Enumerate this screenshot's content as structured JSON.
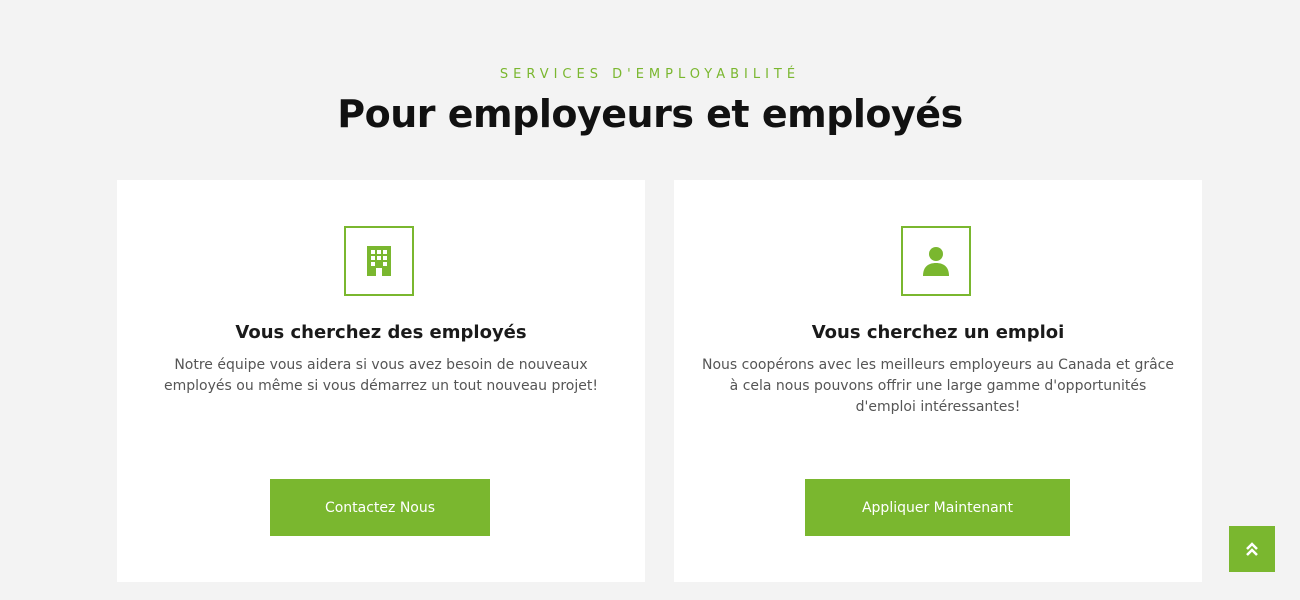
{
  "section": {
    "eyebrow": "SERVICES D'EMPLOYABILITÉ",
    "heading": "Pour employeurs et employés"
  },
  "cards": [
    {
      "icon": "building-icon",
      "title": "Vous cherchez des employés",
      "text": "Notre équipe vous aidera si vous avez besoin de nouveaux employés ou même si vous démarrez un tout nouveau projet!",
      "button_label": "Contactez Nous"
    },
    {
      "icon": "user-icon",
      "title": "Vous cherchez un emploi",
      "text": "Nous coopérons avec les meilleurs employeurs au Canada et grâce à cela nous pouvons offrir une large gamme d'opportunités d'emploi intéressantes!",
      "button_label": "Appliquer Maintenant"
    }
  ],
  "scroll_top": {
    "icon": "double-chevron-up-icon"
  },
  "colors": {
    "accent": "#7ab72f",
    "background": "#f3f3f3",
    "card": "#ffffff",
    "heading": "#111111",
    "body_text": "#555555"
  }
}
